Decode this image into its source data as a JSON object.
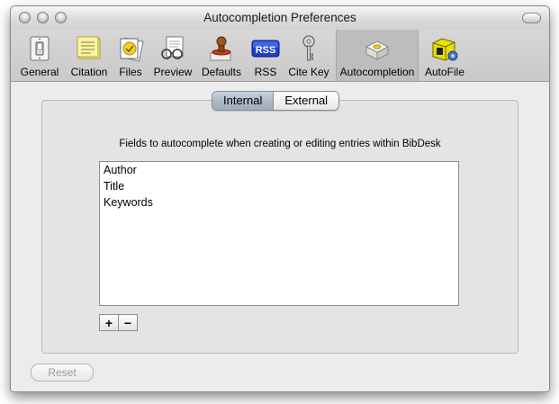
{
  "window": {
    "title": "Autocompletion Preferences"
  },
  "toolbar": {
    "items": [
      {
        "label": "General",
        "icon": "light-switch-icon"
      },
      {
        "label": "Citation",
        "icon": "notepad-icon"
      },
      {
        "label": "Files",
        "icon": "files-icon"
      },
      {
        "label": "Preview",
        "icon": "preview-glasses-icon"
      },
      {
        "label": "Defaults",
        "icon": "stamp-icon"
      },
      {
        "label": "RSS",
        "icon": "rss-icon"
      },
      {
        "label": "Cite Key",
        "icon": "key-icon"
      },
      {
        "label": "Autocompletion",
        "icon": "autocompletion-icon"
      },
      {
        "label": "AutoFile",
        "icon": "autofile-icon"
      }
    ],
    "selected": "Autocompletion",
    "rss_text": "RSS"
  },
  "tabs": {
    "internal": "Internal",
    "external": "External",
    "selected": "Internal"
  },
  "description": "Fields to autocomplete when creating or editing entries within BibDesk",
  "fields": [
    "Author",
    "Title",
    "Keywords"
  ],
  "buttons": {
    "add": "+",
    "remove": "−",
    "reset": "Reset"
  },
  "colors": {
    "window_bg": "#ececec",
    "selected_tab": "#aab7c6",
    "rss_blue": "#1d3fc9"
  }
}
